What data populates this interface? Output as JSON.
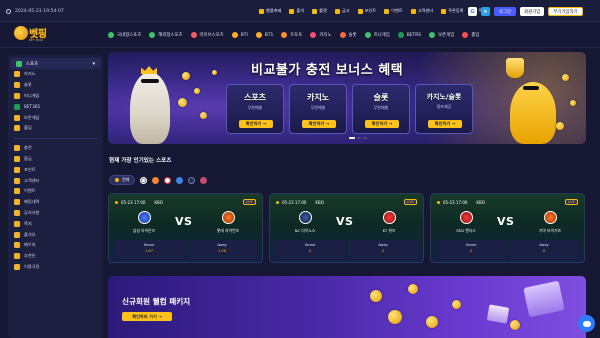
{
  "topbar": {
    "datetime": "2024-05-23 19:54:07",
    "links": [
      "했을축제",
      "출석",
      "룰렛",
      "금고",
      "포인트",
      "이벤트",
      "고객센터",
      "쿠폰등록",
      "쪽지"
    ],
    "buttons": {
      "g": "G",
      "send": "➤",
      "login": "로그인",
      "id_login": "회원가입",
      "join": "무기가입하기"
    }
  },
  "logo": {
    "brand": "벳핑",
    "sub": "BET PING"
  },
  "nav": [
    "국내형스포츠",
    "해외형스포츠",
    "라이브스포츠",
    "BTI",
    "BT1",
    "트토토",
    "카지노",
    "슬롯",
    "미니게임",
    "BETRS",
    "보존게임",
    "홀덤"
  ],
  "sidebar": {
    "group1": [
      {
        "label": "스포츠",
        "icon": "soccer-icon"
      },
      {
        "label": "카지노",
        "icon": "casino-icon"
      },
      {
        "label": "슬롯",
        "icon": "slot-icon"
      },
      {
        "label": "미니게임",
        "icon": "minigame-icon"
      },
      {
        "label": "BET365",
        "icon": "bet365-icon"
      },
      {
        "label": "보존게임",
        "icon": "game-icon"
      },
      {
        "label": "홀덤",
        "icon": "holdem-icon"
      }
    ],
    "group2": [
      {
        "label": "충전",
        "icon": "charge-icon"
      },
      {
        "label": "환급",
        "icon": "refund-icon"
      },
      {
        "label": "포인트",
        "icon": "point-icon"
      },
      {
        "label": "고객센터",
        "icon": "support-icon"
      },
      {
        "label": "이벤트",
        "icon": "event-icon"
      },
      {
        "label": "베팅내역",
        "icon": "history-icon"
      },
      {
        "label": "공지사항",
        "icon": "notice-icon"
      },
      {
        "label": "쪽지",
        "icon": "message-icon"
      },
      {
        "label": "출석부",
        "icon": "calendar-icon"
      },
      {
        "label": "배우자",
        "icon": "friend-icon"
      },
      {
        "label": "추천인",
        "icon": "referral-icon"
      },
      {
        "label": "이용규정",
        "icon": "rules-icon"
      }
    ]
  },
  "banner": {
    "title": "비교불가 충전 보너스 혜택",
    "promos": [
      {
        "title": "스포츠",
        "sub": "무한매충",
        "button": "확인하기 →"
      },
      {
        "title": "카지노",
        "sub": "무한매충",
        "button": "확인하기 →"
      },
      {
        "title": "슬롯",
        "sub": "무한매충",
        "button": "확인하기 →"
      },
      {
        "title": "카지노/슬롯",
        "sub": "콤프제공",
        "button": "확인하기 →"
      }
    ]
  },
  "section": {
    "title": "현재 가장 인기있는 스포츠",
    "filter_all": "전체"
  },
  "matches": [
    {
      "datetime": "05-23 17:00",
      "league": "KBO",
      "live": "LIVE",
      "home": "삼성 라이온즈",
      "away": "롯데 자이언츠",
      "vs": "VS",
      "home_label": "Home",
      "home_odds": "1.67",
      "away_label": "Away",
      "away_odds": "1.96"
    },
    {
      "datetime": "05-23 17:00",
      "league": "KBO",
      "live": "LIVE",
      "home": "NC 다이노스",
      "away": "KT 위즈",
      "vs": "VS",
      "home_label": "Home",
      "home_odds": "0",
      "away_label": "Away",
      "away_odds": "0"
    },
    {
      "datetime": "05-23 17:00",
      "league": "KBO",
      "live": "LIVE",
      "home": "SSG 랜더스",
      "away": "기아 타이거즈",
      "vs": "VS",
      "home_label": "Home",
      "home_odds": "0",
      "away_label": "Away",
      "away_odds": "0"
    }
  ],
  "bottom_banner": {
    "title": "신규회원 웰컴 패키지",
    "button": "확인하러 가기 →"
  },
  "colors": {
    "accent": "#f5b90b",
    "primary": "#4a5cff",
    "bg": "#151733"
  }
}
